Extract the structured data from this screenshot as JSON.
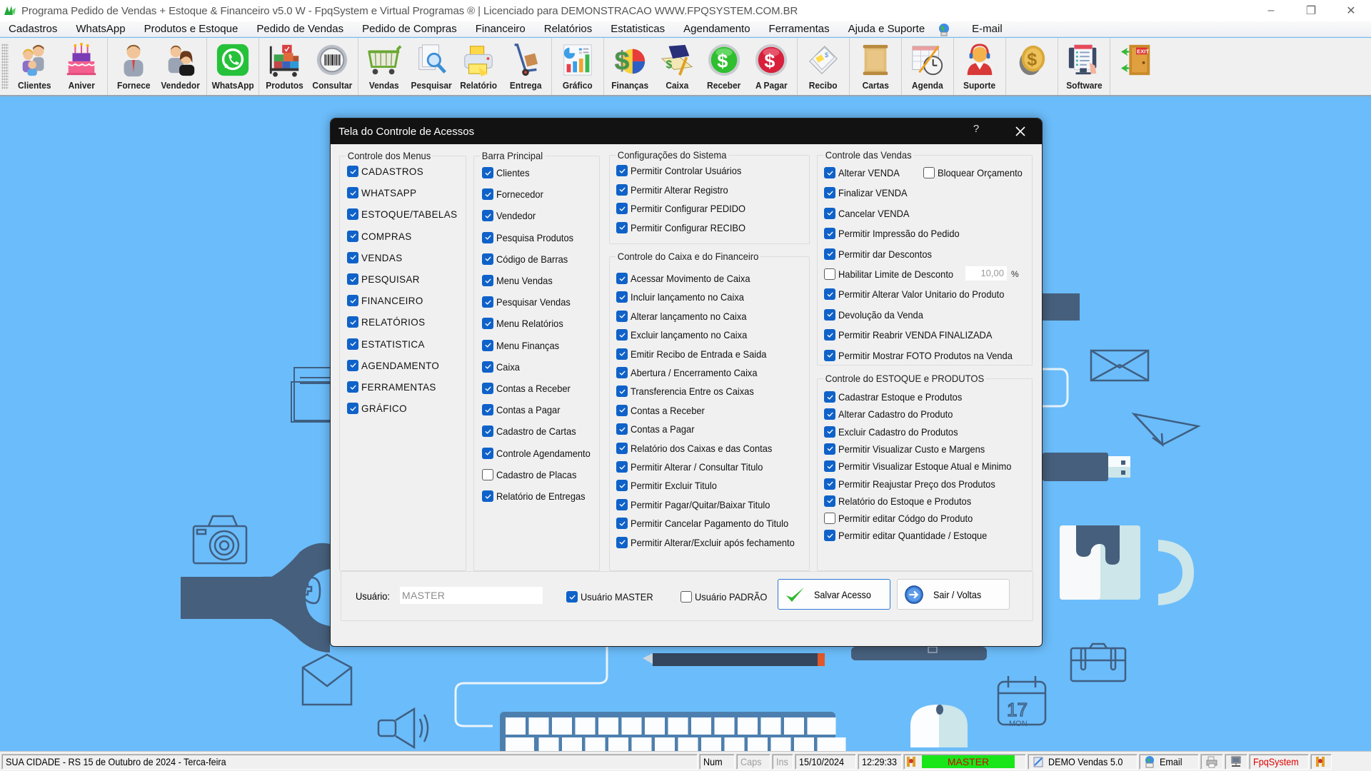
{
  "window": {
    "title": "Programa Pedido de Vendas + Estoque & Financeiro v5.0 W - FpqSystem e Virtual Programas ® | Licenciado para  DEMONSTRACAO WWW.FPQSYSTEM.COM.BR",
    "minimize": "–",
    "restore": "❐",
    "close": "✕"
  },
  "menu": [
    "Cadastros",
    "WhatsApp",
    "Produtos e Estoque",
    "Pedido de Vendas",
    "Pedido de Compras",
    "Financeiro",
    "Relatórios",
    "Estatisticas",
    "Agendamento",
    "Ferramentas",
    "Ajuda e Suporte",
    "E-mail"
  ],
  "toolbar": {
    "groups": [
      [
        {
          "label": "Clientes",
          "icon": "clients-icon"
        },
        {
          "label": "Aniver",
          "icon": "birthday-cake-icon"
        }
      ],
      [
        {
          "label": "Fornece",
          "icon": "supplier-icon"
        },
        {
          "label": "Vendedor",
          "icon": "seller-icon"
        }
      ],
      [
        {
          "label": "WhatsApp",
          "icon": "whatsapp-icon"
        }
      ],
      [
        {
          "label": "Produtos",
          "icon": "products-cart-icon"
        },
        {
          "label": "Consultar",
          "icon": "barcode-icon"
        }
      ],
      [
        {
          "label": "Vendas",
          "icon": "shopping-cart-icon"
        },
        {
          "label": "Pesquisar",
          "icon": "search-document-icon"
        },
        {
          "label": "Relatório",
          "icon": "printer-icon"
        },
        {
          "label": "Entrega",
          "icon": "hand-truck-icon"
        }
      ],
      [
        {
          "label": "Gráfico",
          "icon": "bar-chart-icon"
        }
      ],
      [
        {
          "label": "Finanças",
          "icon": "finance-pie-icon"
        },
        {
          "label": "Caixa",
          "icon": "cash-book-icon"
        },
        {
          "label": "Receber",
          "icon": "receive-money-icon"
        },
        {
          "label": "A Pagar",
          "icon": "pay-money-icon"
        }
      ],
      [
        {
          "label": "Recibo",
          "icon": "receipt-icon"
        }
      ],
      [
        {
          "label": "Cartas",
          "icon": "scroll-letter-icon"
        }
      ],
      [
        {
          "label": "Agenda",
          "icon": "calendar-clock-icon"
        }
      ],
      [
        {
          "label": "Suporte",
          "icon": "support-headset-icon"
        }
      ],
      [
        {
          "label": "",
          "icon": "coin-icon"
        }
      ],
      [
        {
          "label": "Software",
          "icon": "software-monitor-icon"
        }
      ],
      [
        {
          "label": "",
          "icon": "exit-door-icon"
        }
      ]
    ]
  },
  "dialog": {
    "title": "Tela do Controle de Acessos",
    "help": "?",
    "groups": {
      "menus": {
        "title": "Controle dos Menus",
        "items": [
          {
            "label": "CADASTROS",
            "checked": true
          },
          {
            "label": "WHATSAPP",
            "checked": true
          },
          {
            "label": "ESTOQUE/TABELAS",
            "checked": true
          },
          {
            "label": "COMPRAS",
            "checked": true
          },
          {
            "label": "VENDAS",
            "checked": true
          },
          {
            "label": "PESQUISAR",
            "checked": true
          },
          {
            "label": "FINANCEIRO",
            "checked": true
          },
          {
            "label": "RELATÓRIOS",
            "checked": true
          },
          {
            "label": "ESTATISTICA",
            "checked": true
          },
          {
            "label": "AGENDAMENTO",
            "checked": true
          },
          {
            "label": "FERRAMENTAS",
            "checked": true
          },
          {
            "label": "GRÁFICO",
            "checked": true
          }
        ]
      },
      "barra": {
        "title": "Barra Principal",
        "items": [
          {
            "label": "Clientes",
            "checked": true
          },
          {
            "label": "Fornecedor",
            "checked": true
          },
          {
            "label": "Vendedor",
            "checked": true
          },
          {
            "label": "Pesquisa Produtos",
            "checked": true
          },
          {
            "label": "Código de Barras",
            "checked": true
          },
          {
            "label": "Menu Vendas",
            "checked": true
          },
          {
            "label": "Pesquisar Vendas",
            "checked": true
          },
          {
            "label": "Menu Relatórios",
            "checked": true
          },
          {
            "label": "Menu Finanças",
            "checked": true
          },
          {
            "label": "Caixa",
            "checked": true
          },
          {
            "label": "Contas a Receber",
            "checked": true
          },
          {
            "label": "Contas a Pagar",
            "checked": true
          },
          {
            "label": "Cadastro de Cartas",
            "checked": true
          },
          {
            "label": "Controle Agendamento",
            "checked": true
          },
          {
            "label": "Cadastro de Placas",
            "checked": false
          },
          {
            "label": "Relatório de Entregas",
            "checked": true
          }
        ]
      },
      "sistema": {
        "title": "Configurações do Sistema",
        "items": [
          {
            "label": "Permitir Controlar Usuários",
            "checked": true
          },
          {
            "label": "Permitir Alterar Registro",
            "checked": true
          },
          {
            "label": "Permitir Configurar PEDIDO",
            "checked": true
          },
          {
            "label": "Permitir Configurar RECIBO",
            "checked": true
          }
        ]
      },
      "caixa": {
        "title": "Controle do Caixa e do Financeiro",
        "items": [
          {
            "label": "Acessar Movimento de Caixa",
            "checked": true
          },
          {
            "label": "Incluir lançamento no Caixa",
            "checked": true
          },
          {
            "label": "Alterar lançamento no Caixa",
            "checked": true
          },
          {
            "label": "Excluir lançamento no Caixa",
            "checked": true
          },
          {
            "label": "Emitir Recibo de Entrada e Saida",
            "checked": true
          },
          {
            "label": "Abertura / Encerramento Caixa",
            "checked": true
          },
          {
            "label": "Transferencia Entre os Caixas",
            "checked": true
          },
          {
            "label": "Contas a Receber",
            "checked": true
          },
          {
            "label": "Contas a Pagar",
            "checked": true
          },
          {
            "label": "Relatório dos Caixas e das Contas",
            "checked": true
          },
          {
            "label": "Permitir Alterar / Consultar Titulo",
            "checked": true
          },
          {
            "label": "Permitir Excluir Titulo",
            "checked": true
          },
          {
            "label": "Permitir Pagar/Quitar/Baixar Titulo",
            "checked": true
          },
          {
            "label": "Permitir Cancelar Pagamento do Titulo",
            "checked": true
          },
          {
            "label": "Permitir Alterar/Excluir após fechamento",
            "checked": true
          }
        ]
      },
      "vendas": {
        "title": "Controle das Vendas",
        "items": [
          {
            "label": "Alterar VENDA",
            "checked": true
          },
          {
            "label": "Finalizar VENDA",
            "checked": true
          },
          {
            "label": "Cancelar VENDA",
            "checked": true
          },
          {
            "label": "Permitir Impressão do Pedido",
            "checked": true
          },
          {
            "label": "Permitir dar Descontos",
            "checked": true
          },
          {
            "label": "Habilitar Limite de Desconto",
            "checked": false
          },
          {
            "label": "Permitir Alterar Valor Unitario do Produto",
            "checked": true
          },
          {
            "label": "Devolução da Venda",
            "checked": true
          },
          {
            "label": "Permitir Reabrir VENDA FINALIZADA",
            "checked": true
          },
          {
            "label": "Permitir Mostrar FOTO Produtos na Venda",
            "checked": true
          }
        ],
        "bloquear": {
          "label": "Bloquear Orçamento",
          "checked": false
        },
        "limite_value": "10,00",
        "limite_unit": "%"
      },
      "estoque": {
        "title": "Controle do ESTOQUE e PRODUTOS",
        "items": [
          {
            "label": "Cadastrar Estoque e Produtos",
            "checked": true
          },
          {
            "label": "Alterar Cadastro do Produto",
            "checked": true
          },
          {
            "label": "Excluir Cadastro do Produtos",
            "checked": true
          },
          {
            "label": "Permitir Visualizar Custo e Margens",
            "checked": true
          },
          {
            "label": "Permitir Visualizar Estoque Atual e Minimo",
            "checked": true
          },
          {
            "label": "Permitir Reajustar Preço dos Produtos",
            "checked": true
          },
          {
            "label": "Relatório do Estoque e Produtos",
            "checked": true
          },
          {
            "label": "Permitir editar Códgo do Produto",
            "checked": false
          },
          {
            "label": "Permitir editar Quantidade / Estoque",
            "checked": true
          }
        ]
      }
    },
    "footer": {
      "usuario_label": "Usuário:",
      "usuario_value": "MASTER",
      "master": {
        "label": "Usuário MASTER",
        "checked": true
      },
      "padrao": {
        "label": "Usuário PADRÃO",
        "checked": false
      },
      "save_label": "Salvar Acesso",
      "exit_label": "Sair / Voltas"
    }
  },
  "statusbar": {
    "location_date": "SUA CIDADE - RS 15 de Outubro de 2024 - Terca-feira",
    "num": "Num",
    "caps": "Caps",
    "ins": "Ins",
    "date": "15/10/2024",
    "time": "12:29:33",
    "user": "MASTER",
    "version": "DEMO Vendas 5.0",
    "email": "Email",
    "brand": "FpqSystem"
  },
  "colors": {
    "background": "#6bbcfa",
    "checkbox_checked": "#0f62c9",
    "dialog_titlebar": "#121212",
    "status_user_bg": "#19e619",
    "status_user_text": "#d60000",
    "brand_text": "#e00000"
  }
}
